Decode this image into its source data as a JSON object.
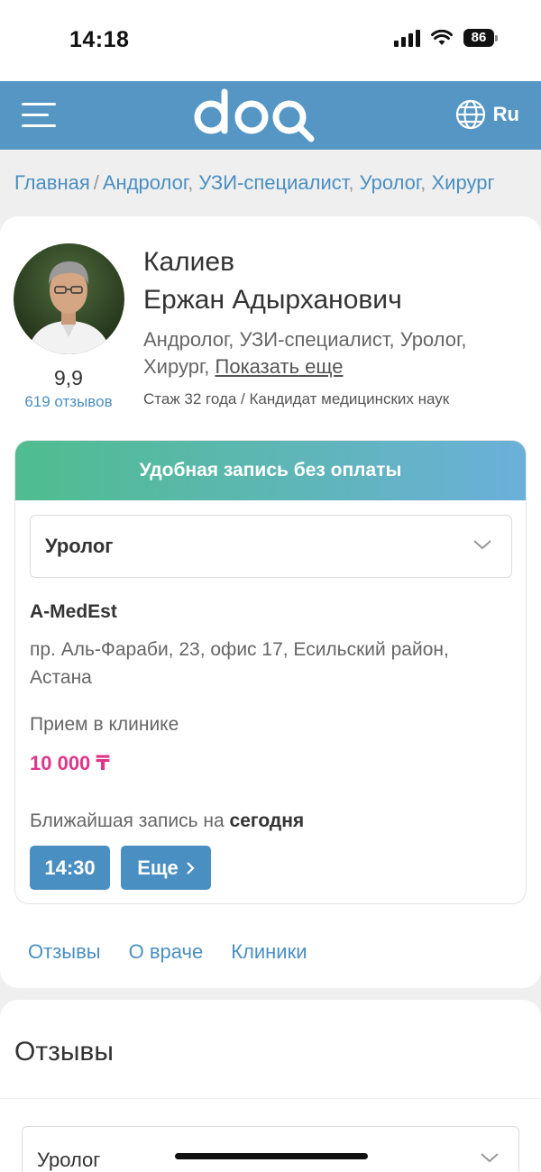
{
  "status_bar": {
    "time": "14:18",
    "battery": "86"
  },
  "header": {
    "logo": "doq",
    "language": "Ru"
  },
  "breadcrumb": {
    "home": "Главная",
    "separator": "/",
    "items": [
      "Андролог",
      "УЗИ-специалист",
      "Уролог",
      "Хирург"
    ]
  },
  "doctor": {
    "last_name": "Калиев",
    "first_names": "Ержан Адырханович",
    "rating": "9,9",
    "reviews_count": "619 отзывов",
    "specialties": "Андролог, УЗИ-специалист, Уролог, Хирург,",
    "show_more": "Показать еще",
    "experience": "Стаж 32 года / Кандидат медицинских наук"
  },
  "booking": {
    "banner": "Удобная запись без оплаты",
    "selected_specialty": "Уролог",
    "clinic_name": "A-MedEst",
    "clinic_address": "пр. Аль-Фараби, 23, офис 17, Есильский район, Астана",
    "visit_type": "Прием в клинике",
    "price": "10 000 ₸",
    "nearest_prefix": "Ближайшая запись на",
    "nearest_day": "сегодня",
    "slot_time": "14:30",
    "more_label": "Еще"
  },
  "tabs": [
    "Отзывы",
    "О враче",
    "Клиники"
  ],
  "reviews_section": {
    "title": "Отзывы",
    "filter_value": "Уролог"
  },
  "colors": {
    "header_bg": "#5596c4",
    "link": "#4a8fc2",
    "price": "#e0358a",
    "banner_gradient_start": "#4fbd8e",
    "banner_gradient_end": "#6bb0d9"
  }
}
